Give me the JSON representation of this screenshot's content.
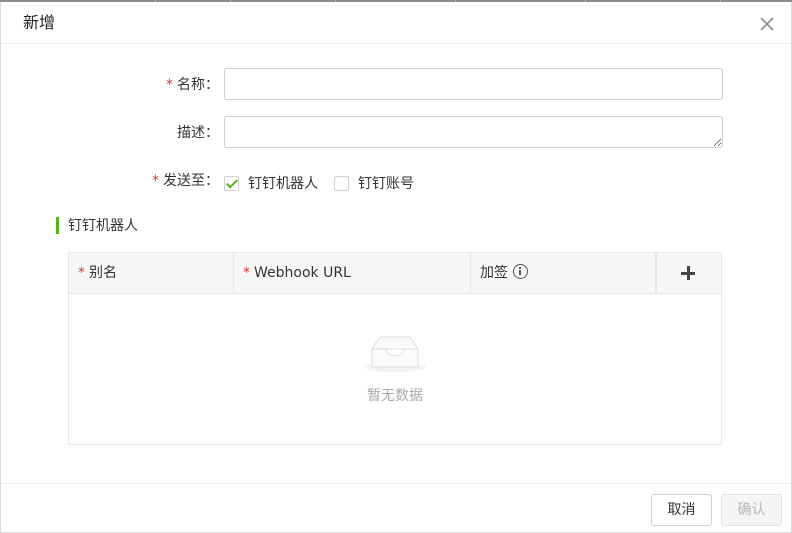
{
  "dialog": {
    "title": "新增"
  },
  "form": {
    "name": {
      "label": "名称：",
      "required_mark": "*",
      "value": "",
      "placeholder": ""
    },
    "description": {
      "label": "描述：",
      "value": "",
      "placeholder": ""
    },
    "send_to": {
      "label": "发送至：",
      "required_mark": "*",
      "options": [
        {
          "label": "钉钉机器人",
          "checked": true
        },
        {
          "label": "钉钉账号",
          "checked": false
        }
      ]
    }
  },
  "section": {
    "title": "钉钉机器人"
  },
  "table": {
    "columns": [
      {
        "label": "别名",
        "required": true,
        "required_mark": "*"
      },
      {
        "label": "Webhook URL",
        "required": true,
        "required_mark": "*"
      },
      {
        "label": "加签",
        "required": false,
        "icon": "info-circle-icon"
      }
    ],
    "add_icon": "plus-icon",
    "rows": [],
    "empty_text": "暂无数据"
  },
  "footer": {
    "cancel_label": "取消",
    "confirm_label": "确认",
    "confirm_disabled": true
  },
  "colors": {
    "accent": "#52b61a",
    "required": "#e0362c",
    "empty_text": "#a8a8a8"
  }
}
